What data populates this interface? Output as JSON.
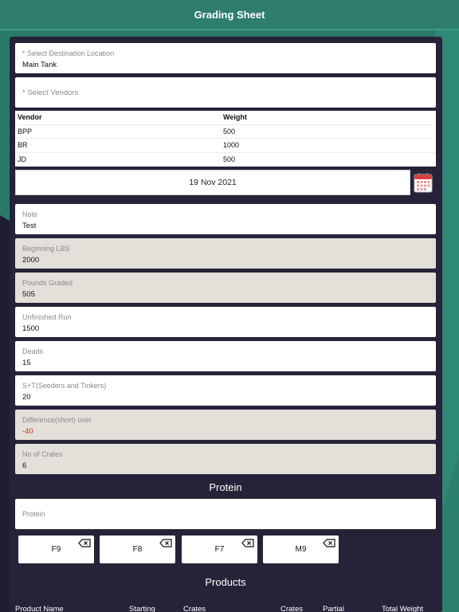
{
  "header": {
    "title": "Grading Sheet"
  },
  "destination": {
    "label": "* Select Destination Location",
    "value": "Main Tank"
  },
  "vendors_select": {
    "placeholder": "* Select Vendors"
  },
  "vendor_table": {
    "columns": [
      "Vendor",
      "Weight"
    ],
    "rows": [
      [
        "BPP",
        "500"
      ],
      [
        "BR",
        "1000"
      ],
      [
        "JD",
        "500"
      ]
    ]
  },
  "date": {
    "value": "19 Nov 2021"
  },
  "fields": {
    "note": {
      "label": "Note",
      "value": "Test"
    },
    "beginning_lbs": {
      "label": "Beginning LBS",
      "value": "2000"
    },
    "pounds_graded": {
      "label": "Pounds Graded",
      "value": "505"
    },
    "unfinished_run": {
      "label": "Unfinished Run",
      "value": "1500"
    },
    "deads": {
      "label": "Deads",
      "value": "15"
    },
    "seeders_tinkers": {
      "label": "S+T(Seeders and Tinkers)",
      "value": "20"
    },
    "difference": {
      "label": "Difference(short) over",
      "value": "-40"
    },
    "no_of_crates": {
      "label": "No of Crates",
      "value": "6"
    }
  },
  "protein": {
    "title": "Protein",
    "placeholder": "Protein",
    "chips": [
      "F9",
      "F8",
      "F7",
      "M9"
    ]
  },
  "products": {
    "title": "Products",
    "columns": [
      "Product Name",
      "Starting",
      "Crates",
      "Crates",
      "Partial",
      "Total Weight"
    ]
  },
  "colors": {
    "header_bg": "#2f7d6f",
    "panel_bg": "#262339",
    "readonly_field_bg": "#e3e0da",
    "negative_value": "#d8232a"
  }
}
